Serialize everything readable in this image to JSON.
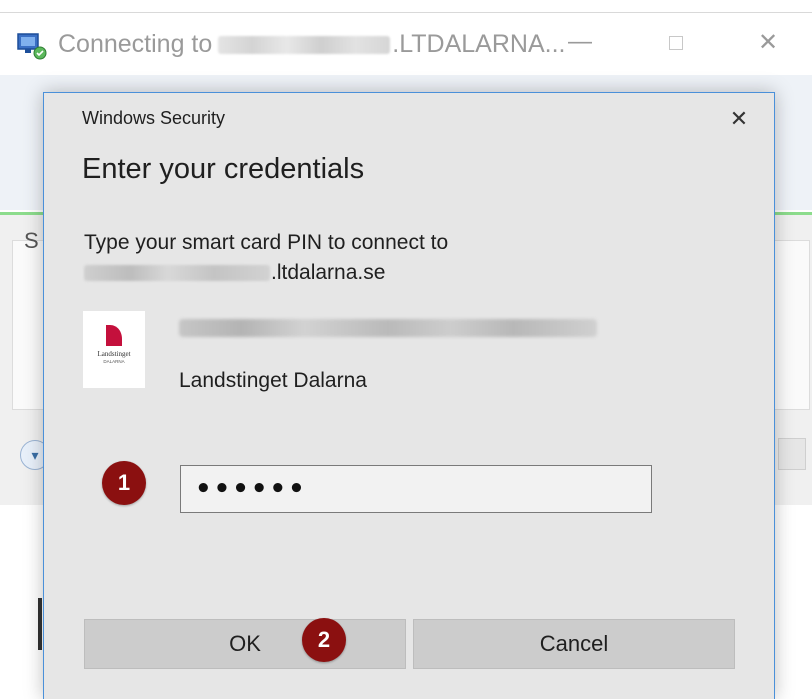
{
  "background_window": {
    "title_prefix": "Connecting to",
    "title_suffix": ".LTDALARNA...",
    "minimize": "—",
    "close": "✕",
    "partial_label": "S"
  },
  "dialog": {
    "caption": "Windows Security",
    "close": "✕",
    "heading": "Enter your credentials",
    "prompt_line1": "Type your smart card PIN to connect to",
    "host_suffix": ".ltdalarna.se",
    "card_org": "Landstinget Dalarna",
    "card_logo_text": "Landstinget",
    "card_logo_subtext": "DALARNA",
    "pin_value": "••••••",
    "ok_label": "OK",
    "cancel_label": "Cancel"
  },
  "badges": {
    "step1": "1",
    "step2": "2"
  },
  "colors": {
    "accent_border": "#4a90d9",
    "badge": "#8b1010",
    "logo": "#c4103c",
    "success_line": "#8cdc8c"
  }
}
